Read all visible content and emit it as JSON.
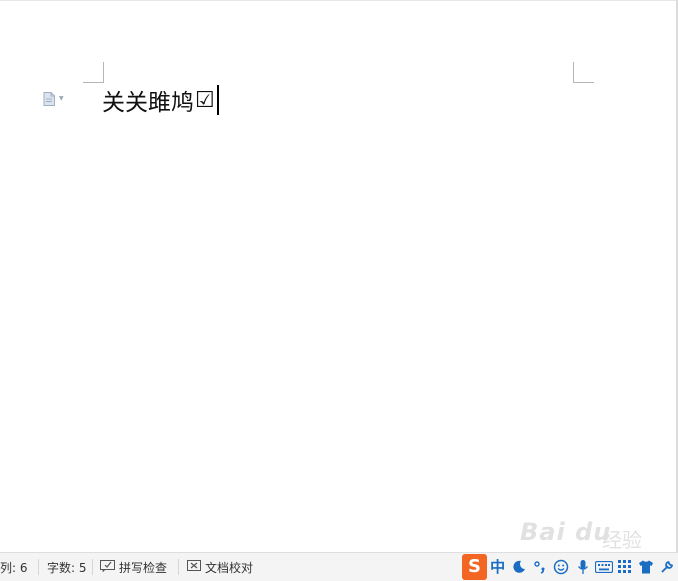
{
  "document": {
    "text": "关关雎鸠",
    "symbol": "☑"
  },
  "statusbar": {
    "column": "列: 6",
    "word_count": "字数: 5",
    "spell_check": "拼写检查",
    "doc_proofread": "文档校对"
  },
  "ime": {
    "logo": "S",
    "mode": "中"
  },
  "watermark": {
    "brand": "Bai  du",
    "product": "经验"
  },
  "colors": {
    "ime_accent": "#1a6dc2",
    "ime_logo": "#f26522"
  }
}
